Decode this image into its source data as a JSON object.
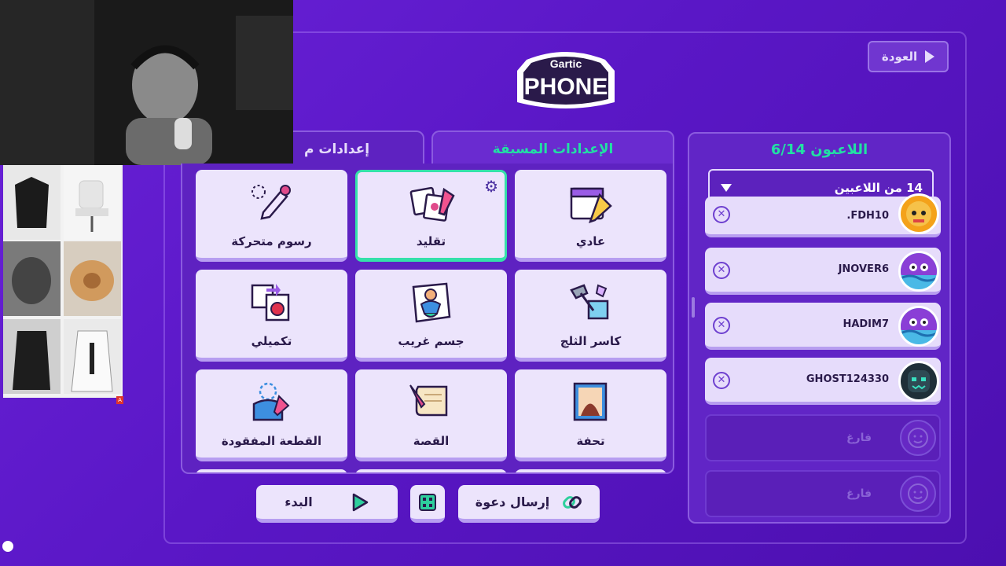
{
  "back_button": {
    "label": "العودة"
  },
  "logo": {
    "top_text": "Gartic",
    "main_text": "PHONE"
  },
  "players": {
    "title": "اللاعبون 6/14",
    "max_select": "14 من اللاعبين",
    "list": [
      {
        "name": ".FDH10",
        "remove": "✕"
      },
      {
        "name": "JNOVER6",
        "remove": "✕"
      },
      {
        "name": "HADIM7",
        "remove": "✕"
      },
      {
        "name": "GHOST124330",
        "remove": "✕"
      }
    ],
    "empty_slots": [
      "فارغ",
      "فارغ"
    ]
  },
  "tabs": {
    "presets": "الإعدادات المسبقة",
    "custom": "إعدادات م"
  },
  "modes": [
    {
      "label": "عادي",
      "icon": "calendar-pencil-icon"
    },
    {
      "label": "تقليد",
      "icon": "copy-drawings-icon",
      "selected": true
    },
    {
      "label": "رسوم متحركة",
      "icon": "animation-pencil-icon"
    },
    {
      "label": "كاسر الثلج",
      "icon": "ice-hammer-icon"
    },
    {
      "label": "جسم غريب",
      "icon": "strange-body-icon"
    },
    {
      "label": "تكميلي",
      "icon": "puzzle-apple-icon"
    },
    {
      "label": "تحفة",
      "icon": "masterpiece-icon"
    },
    {
      "label": "القصة",
      "icon": "scroll-quill-icon"
    },
    {
      "label": "القطعة المفقودة",
      "icon": "missing-piece-icon"
    }
  ],
  "actions": {
    "invite": "إرسال دعوة",
    "start": "البدء"
  },
  "colors": {
    "background": "#5a17c6",
    "accent": "#22e0a3",
    "card": "#ece4fc",
    "text_dark": "#2a1a4a"
  }
}
